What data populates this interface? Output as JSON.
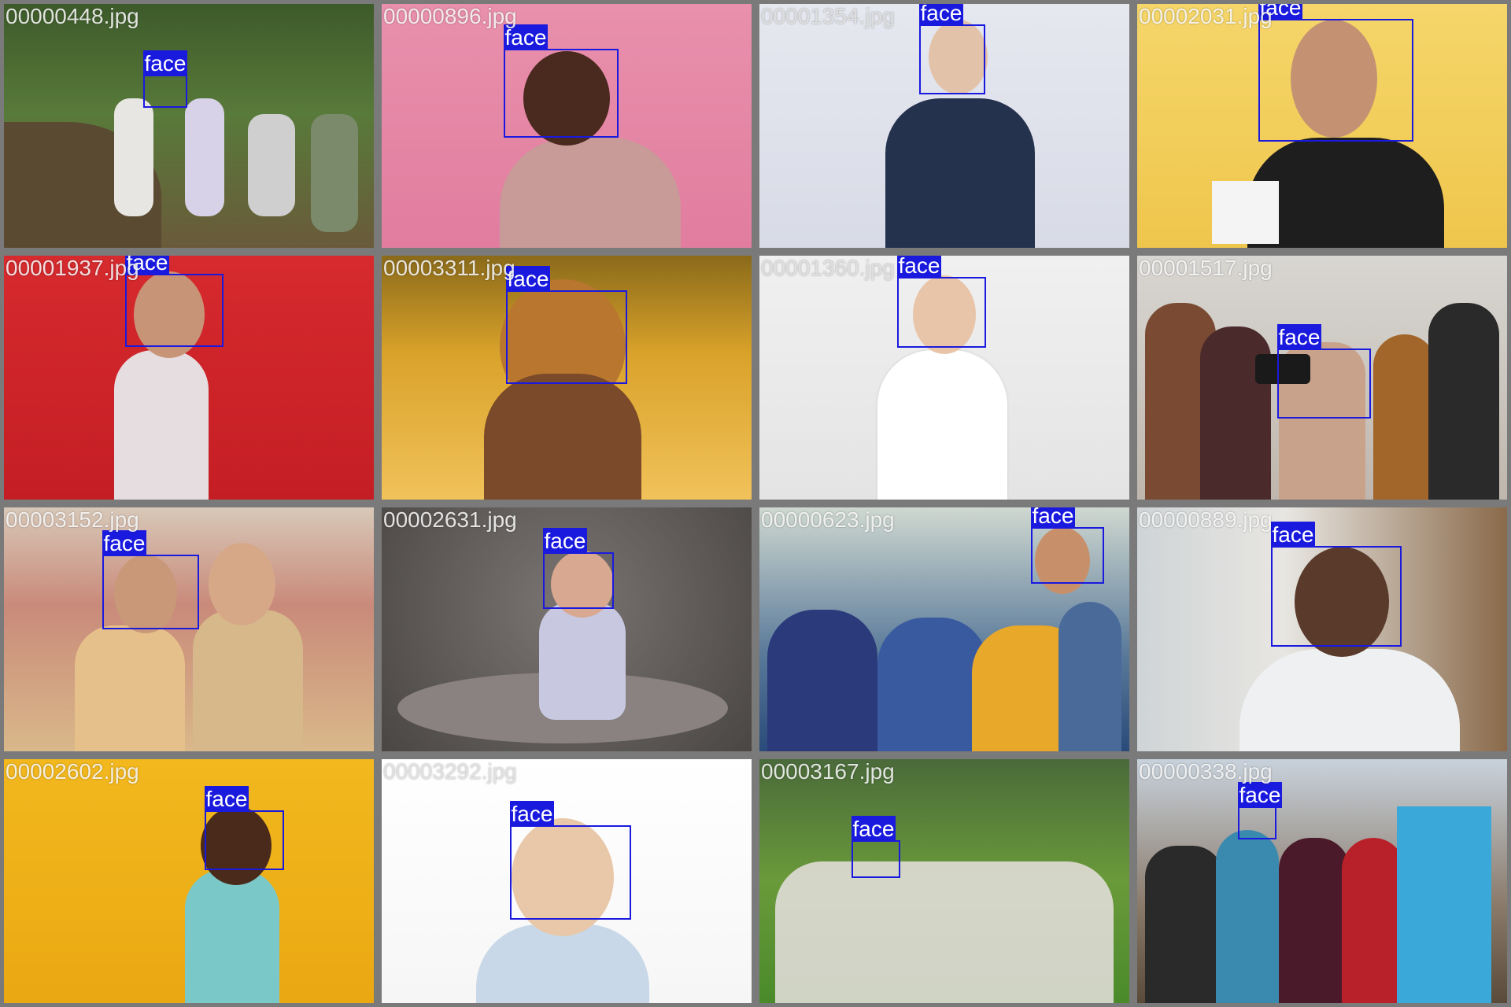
{
  "tiles": [
    {
      "filename": "00000448.jpg",
      "label": "face",
      "bg": "linear-gradient(180deg,#3d5a2a 0%,#587a3a 45%,#6a5a3a 100%)"
    },
    {
      "filename": "00000896.jpg",
      "label": "face",
      "bg": "linear-gradient(180deg,#e890ac 0%,#e27d9f 100%)"
    },
    {
      "filename": "00001354.jpg",
      "label": "face",
      "bg": "linear-gradient(180deg,#e6e8f0 0%,#d8dbe6 100%)"
    },
    {
      "filename": "00002031.jpg",
      "label": "face",
      "bg": "linear-gradient(180deg,#f5d66a 0%,#efc64c 100%)"
    },
    {
      "filename": "00001937.jpg",
      "label": "face",
      "bg": "linear-gradient(180deg,#d62a2e 0%,#c41e24 100%)"
    },
    {
      "filename": "00003311.jpg",
      "label": "face",
      "bg": "linear-gradient(180deg,#8a6a1a 0%,#d9a22a 40%,#f1c25a 100%)"
    },
    {
      "filename": "00001360.jpg",
      "label": "face",
      "bg": "linear-gradient(180deg,#f0f0f0 0%,#e4e4e4 100%)"
    },
    {
      "filename": "00001517.jpg",
      "label": "face",
      "bg": "linear-gradient(180deg,#d8d6d2 0%,#bfb7ad 100%)"
    },
    {
      "filename": "00003152.jpg",
      "label": "face",
      "bg": "linear-gradient(180deg,#d8c8b8 0%,#c98a7a 40%,#d9b88a 100%)"
    },
    {
      "filename": "00002631.jpg",
      "label": "face",
      "bg": "radial-gradient(circle at 50% 40%,#7a7572 0%,#4a4644 100%)"
    },
    {
      "filename": "00000623.jpg",
      "label": "face",
      "bg": "linear-gradient(180deg,#cfd8d0 0%,#5a7a9a 60%,#2a4a7a 100%)"
    },
    {
      "filename": "00000889.jpg",
      "label": "face",
      "bg": "linear-gradient(90deg,#cfd4d6 0%,#e8e6e2 40%,#8a6a4a 100%)"
    },
    {
      "filename": "00002602.jpg",
      "label": "face",
      "bg": "linear-gradient(180deg,#f2b81e 0%,#eaa812 100%)"
    },
    {
      "filename": "00003292.jpg",
      "label": "face",
      "bg": "linear-gradient(180deg,#ffffff 0%,#f6f6f6 100%)"
    },
    {
      "filename": "00003167.jpg",
      "label": "face",
      "bg": "linear-gradient(180deg,#4a6a3a 0%,#6a9a3a 50%,#4a8a2a 100%)"
    },
    {
      "filename": "00000338.jpg",
      "label": "face",
      "bg": "linear-gradient(180deg,#c8d2dc 0%,#8a7a6a 60%,#5a4a3a 100%)"
    }
  ]
}
